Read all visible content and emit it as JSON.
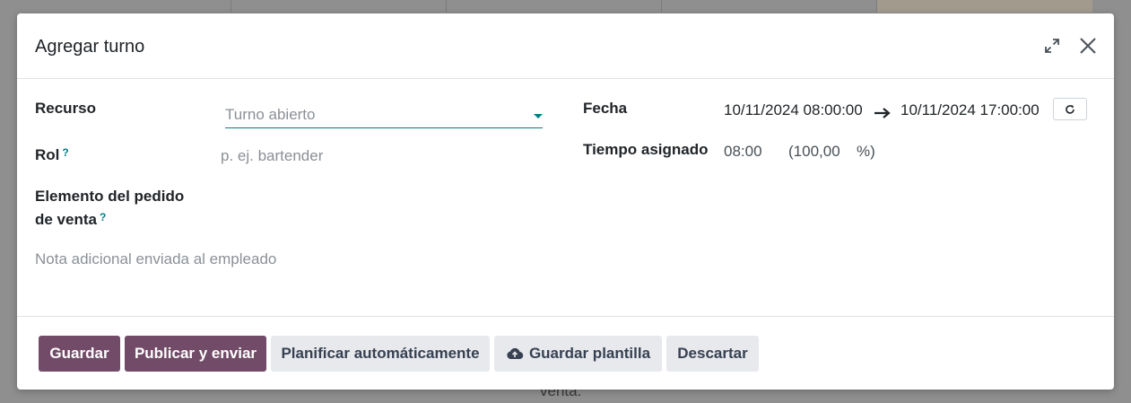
{
  "background": {
    "partial_text": "venta."
  },
  "modal": {
    "title": "Agregar turno",
    "fields": {
      "resource": {
        "label": "Recurso",
        "placeholder": "Turno abierto"
      },
      "role": {
        "label": "Rol",
        "help": "?",
        "placeholder": "p. ej. bartender"
      },
      "sale_line": {
        "label_line1": "Elemento del pedido",
        "label_line2": "de venta",
        "help": "?"
      },
      "note": {
        "placeholder": "Nota adicional enviada al empleado"
      },
      "date": {
        "label": "Fecha",
        "start": "10/11/2024 08:00:00",
        "end": "10/11/2024 17:00:00"
      },
      "allocated": {
        "label": "Tiempo asignado",
        "hours": "08:00",
        "percent_open": "(100,00",
        "percent_close": "%)"
      }
    },
    "footer": {
      "save": "Guardar",
      "publish": "Publicar y enviar",
      "auto_plan": "Planificar automáticamente",
      "save_template": "Guardar plantilla",
      "discard": "Descartar"
    }
  },
  "colors": {
    "primary": "#714b67",
    "accent": "#017e84",
    "secondary_bg": "#e7e9ed"
  }
}
